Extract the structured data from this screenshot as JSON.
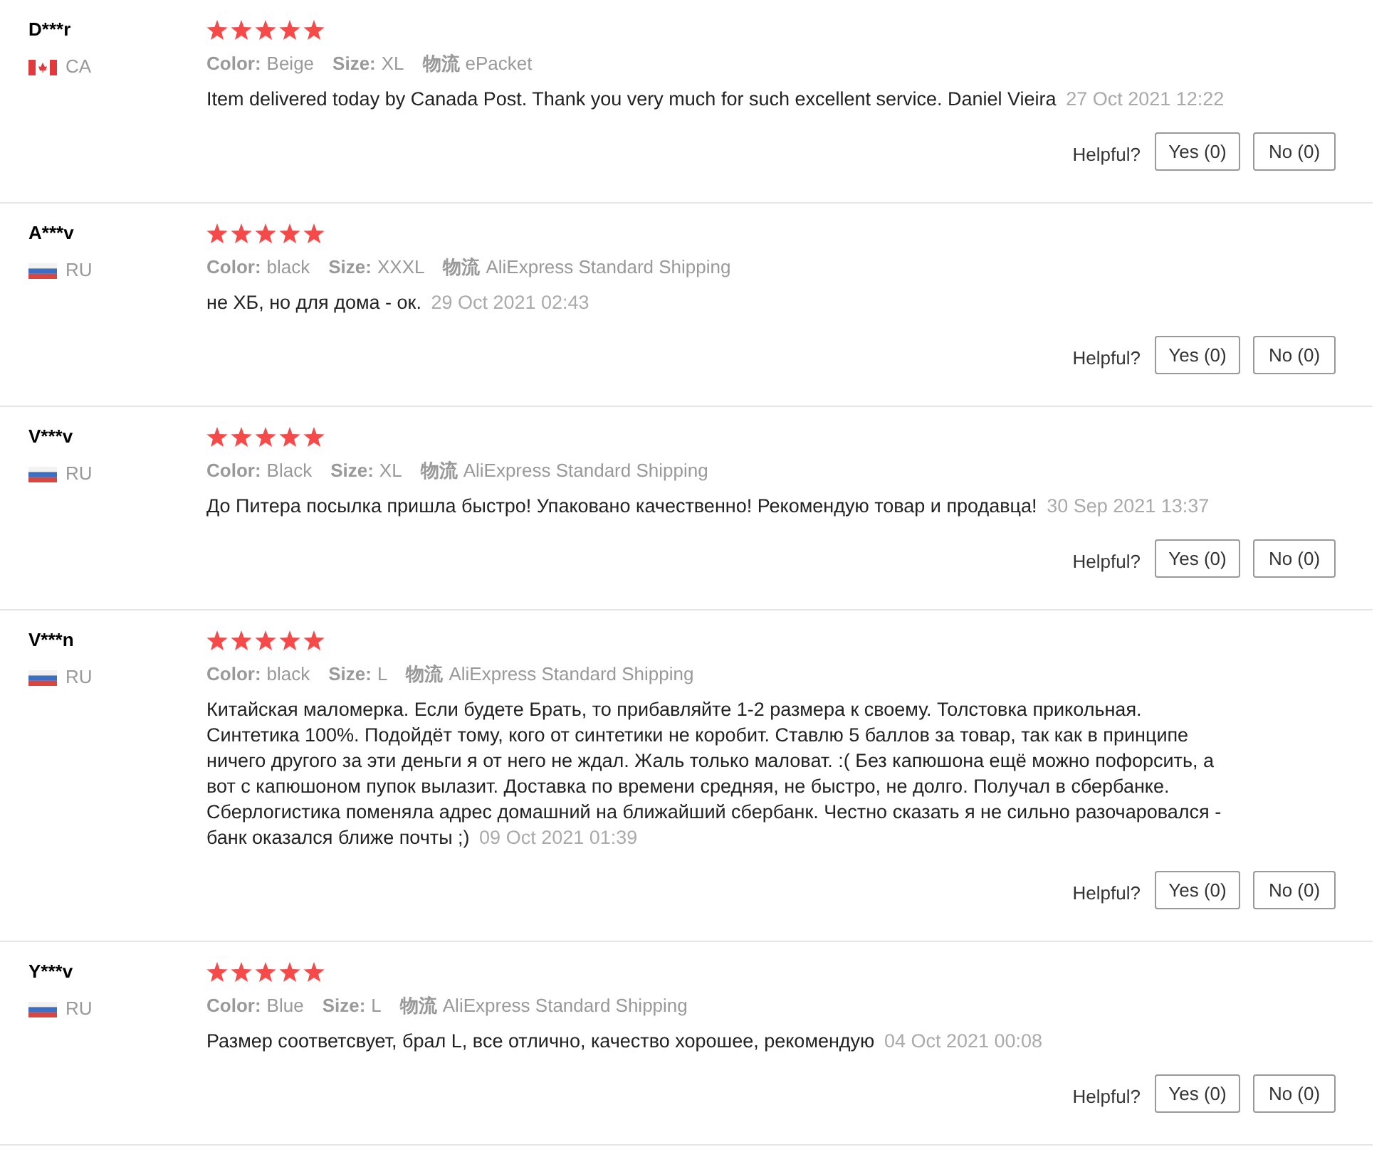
{
  "reviews": [
    {
      "name": "D***r",
      "kind": "ca",
      "country": "CA",
      "stars": 5,
      "attributes": [
        {
          "label": "Color:",
          "value": "Beige"
        },
        {
          "label": "Size:",
          "value": "XL"
        },
        {
          "label": "物流",
          "value": "ePacket"
        }
      ],
      "text": "Item delivered today by Canada Post. Thank you very much for such excellent service. Daniel Vieira",
      "date": "27 Oct 2021 12:22",
      "helpful": "Helpful?",
      "yes": "Yes (0)",
      "no": "No (0)"
    },
    {
      "name": "A***v",
      "kind": "ru",
      "country": "RU",
      "stars": 5,
      "attributes": [
        {
          "label": "Color:",
          "value": "black"
        },
        {
          "label": "Size:",
          "value": "XXXL"
        },
        {
          "label": "物流",
          "value": "AliExpress Standard Shipping"
        }
      ],
      "text": "не ХБ, но для дома - ок.",
      "date": "29 Oct 2021 02:43",
      "helpful": "Helpful?",
      "yes": "Yes (0)",
      "no": "No (0)"
    },
    {
      "name": "V***v",
      "kind": "ru",
      "country": "RU",
      "stars": 5,
      "attributes": [
        {
          "label": "Color:",
          "value": "Black"
        },
        {
          "label": "Size:",
          "value": "XL"
        },
        {
          "label": "物流",
          "value": "AliExpress Standard Shipping"
        }
      ],
      "text": "До Питера посылка пришла быстро! Упаковано качественно! Рекомендую товар и продавца!",
      "date": "30 Sep 2021 13:37",
      "helpful": "Helpful?",
      "yes": "Yes (0)",
      "no": "No (0)"
    },
    {
      "name": "V***n",
      "kind": "ru",
      "country": "RU",
      "stars": 5,
      "attributes": [
        {
          "label": "Color:",
          "value": "black"
        },
        {
          "label": "Size:",
          "value": "L"
        },
        {
          "label": "物流",
          "value": "AliExpress Standard Shipping"
        }
      ],
      "text": "Китайская маломерка. Если будете Брать, то прибавляйте 1-2 размера к своему. Толстовка прикольная. Синтетика 100%. Подойдёт тому, кого от синтетики не коробит. Ставлю 5 баллов за товар, так как в принципе ничего другого за эти деньги я от него не ждал. Жаль только маловат. :( Без капюшона ещё можно пофорсить, а вот с капюшоном пупок вылазит. Доставка по времени средняя, не быстро, не долго. Получал в сбербанке. Сберлогистика поменяла адрес домашний на ближайший сбербанк. Честно сказать я не сильно разочаровался - банк оказался ближе почты ;)",
      "date": "09 Oct 2021 01:39",
      "helpful": "Helpful?",
      "yes": "Yes (0)",
      "no": "No (0)"
    },
    {
      "name": "Y***v",
      "kind": "ru",
      "country": "RU",
      "stars": 5,
      "attributes": [
        {
          "label": "Color:",
          "value": "Blue"
        },
        {
          "label": "Size:",
          "value": "L"
        },
        {
          "label": "物流",
          "value": "AliExpress Standard Shipping"
        }
      ],
      "text": "Размер соответсвует, брал L, все отлично, качество хорошее, рекомендую",
      "date": "04 Oct 2021 00:08",
      "helpful": "Helpful?",
      "yes": "Yes (0)",
      "no": "No (0)"
    }
  ]
}
